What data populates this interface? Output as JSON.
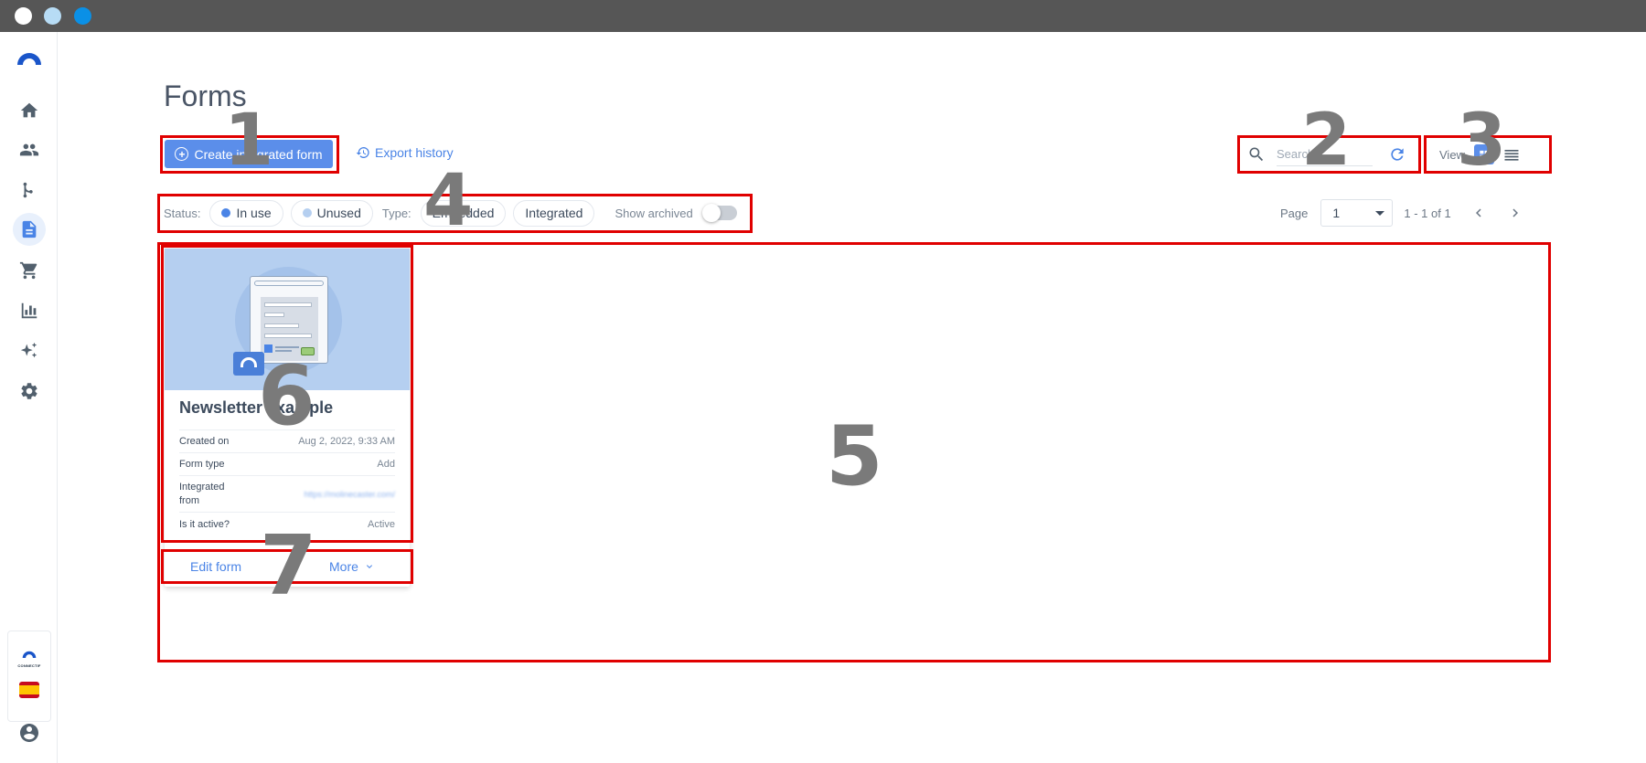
{
  "page": {
    "title": "Forms"
  },
  "toolbar": {
    "create_label": "Create integrated form",
    "export_label": "Export history",
    "search_placeholder": "Search",
    "view_label": "View"
  },
  "filters": {
    "status_label": "Status:",
    "in_use": "In use",
    "unused": "Unused",
    "type_label": "Type:",
    "embedded": "Embedded",
    "integrated": "Integrated",
    "show_archived": "Show archived",
    "colors": {
      "in_use_dot": "#4a84e6",
      "unused_dot": "#b5cff0"
    }
  },
  "pagination": {
    "label": "Page",
    "value": "1",
    "range": "1 - 1 of 1"
  },
  "card": {
    "title": "Newsletter example",
    "rows": [
      {
        "key": "Created on",
        "value": "Aug 2, 2022, 9:33 AM"
      },
      {
        "key": "Form type",
        "value": "Add"
      },
      {
        "key": "Integrated from",
        "value": "https://molinecaster.com/"
      },
      {
        "key": "Is it active?",
        "value": "Active"
      }
    ],
    "edit_label": "Edit form",
    "more_label": "More"
  },
  "sidebar": {
    "items": [
      "home-icon",
      "contacts-icon",
      "workflow-icon",
      "forms-icon",
      "cart-icon",
      "analytics-icon",
      "ai-sparkle-icon",
      "settings-icon"
    ],
    "brand_text": "CONNECTIF"
  },
  "annotations": [
    "1",
    "2",
    "3",
    "4",
    "5",
    "6",
    "7"
  ],
  "colors": {
    "accent": "#5b8eea",
    "annotation_box": "#e00000",
    "annotation_number": "#7a7a7a"
  }
}
